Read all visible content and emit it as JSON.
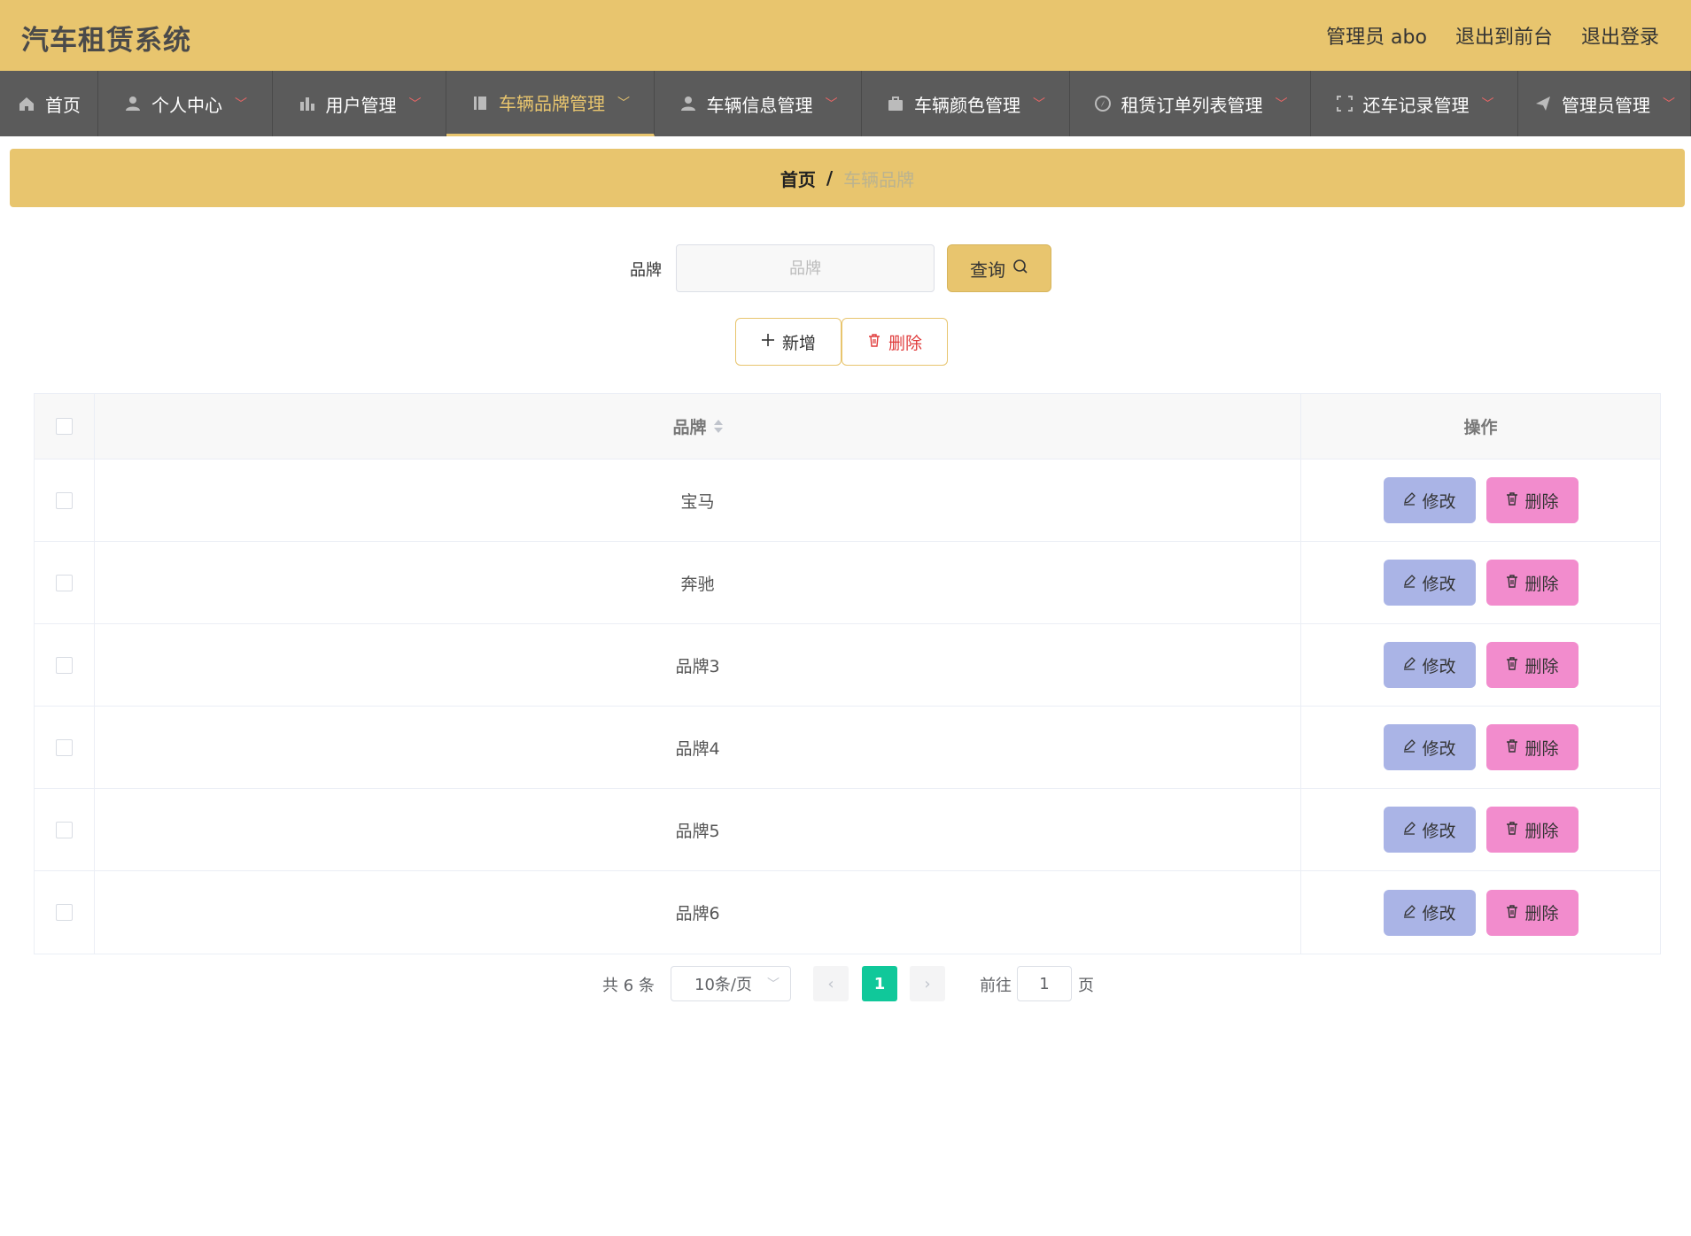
{
  "header": {
    "title": "汽车租赁系统",
    "user": "管理员 abo",
    "to_front": "退出到前台",
    "logout": "退出登录"
  },
  "nav": {
    "items": [
      {
        "label": "首页",
        "icon": "home-icon"
      },
      {
        "label": "个人中心",
        "icon": "user-icon"
      },
      {
        "label": "用户管理",
        "icon": "bar-chart-icon"
      },
      {
        "label": "车辆品牌管理",
        "icon": "book-icon"
      },
      {
        "label": "车辆信息管理",
        "icon": "user-icon"
      },
      {
        "label": "车辆颜色管理",
        "icon": "briefcase-icon"
      },
      {
        "label": "租赁订单列表管理",
        "icon": "compass-icon"
      },
      {
        "label": "还车记录管理",
        "icon": "frame-icon"
      },
      {
        "label": "管理员管理",
        "icon": "send-icon"
      }
    ]
  },
  "breadcrumb": {
    "home": "首页",
    "separator": "/",
    "current": "车辆品牌"
  },
  "search": {
    "label": "品牌",
    "placeholder": "品牌",
    "query_label": "查询"
  },
  "actions": {
    "add_label": "新增",
    "delete_label": "删除"
  },
  "table": {
    "columns": [
      "品牌",
      "操作"
    ],
    "rows": [
      "宝马",
      "奔驰",
      "品牌3",
      "品牌4",
      "品牌5",
      "品牌6"
    ],
    "edit_label": "修改",
    "delete_label": "删除"
  },
  "pagination": {
    "total": "共 6 条",
    "page_size": "10条/页",
    "current": "1",
    "goto": "前往",
    "goto_value": "1",
    "page_suffix": "页"
  },
  "colors": {
    "accent": "#e8c56e",
    "nav_bg": "#5b5b5b",
    "edit_btn": "#aab4e6",
    "delete_btn": "#f28ccd",
    "page_active": "#10c89a"
  }
}
